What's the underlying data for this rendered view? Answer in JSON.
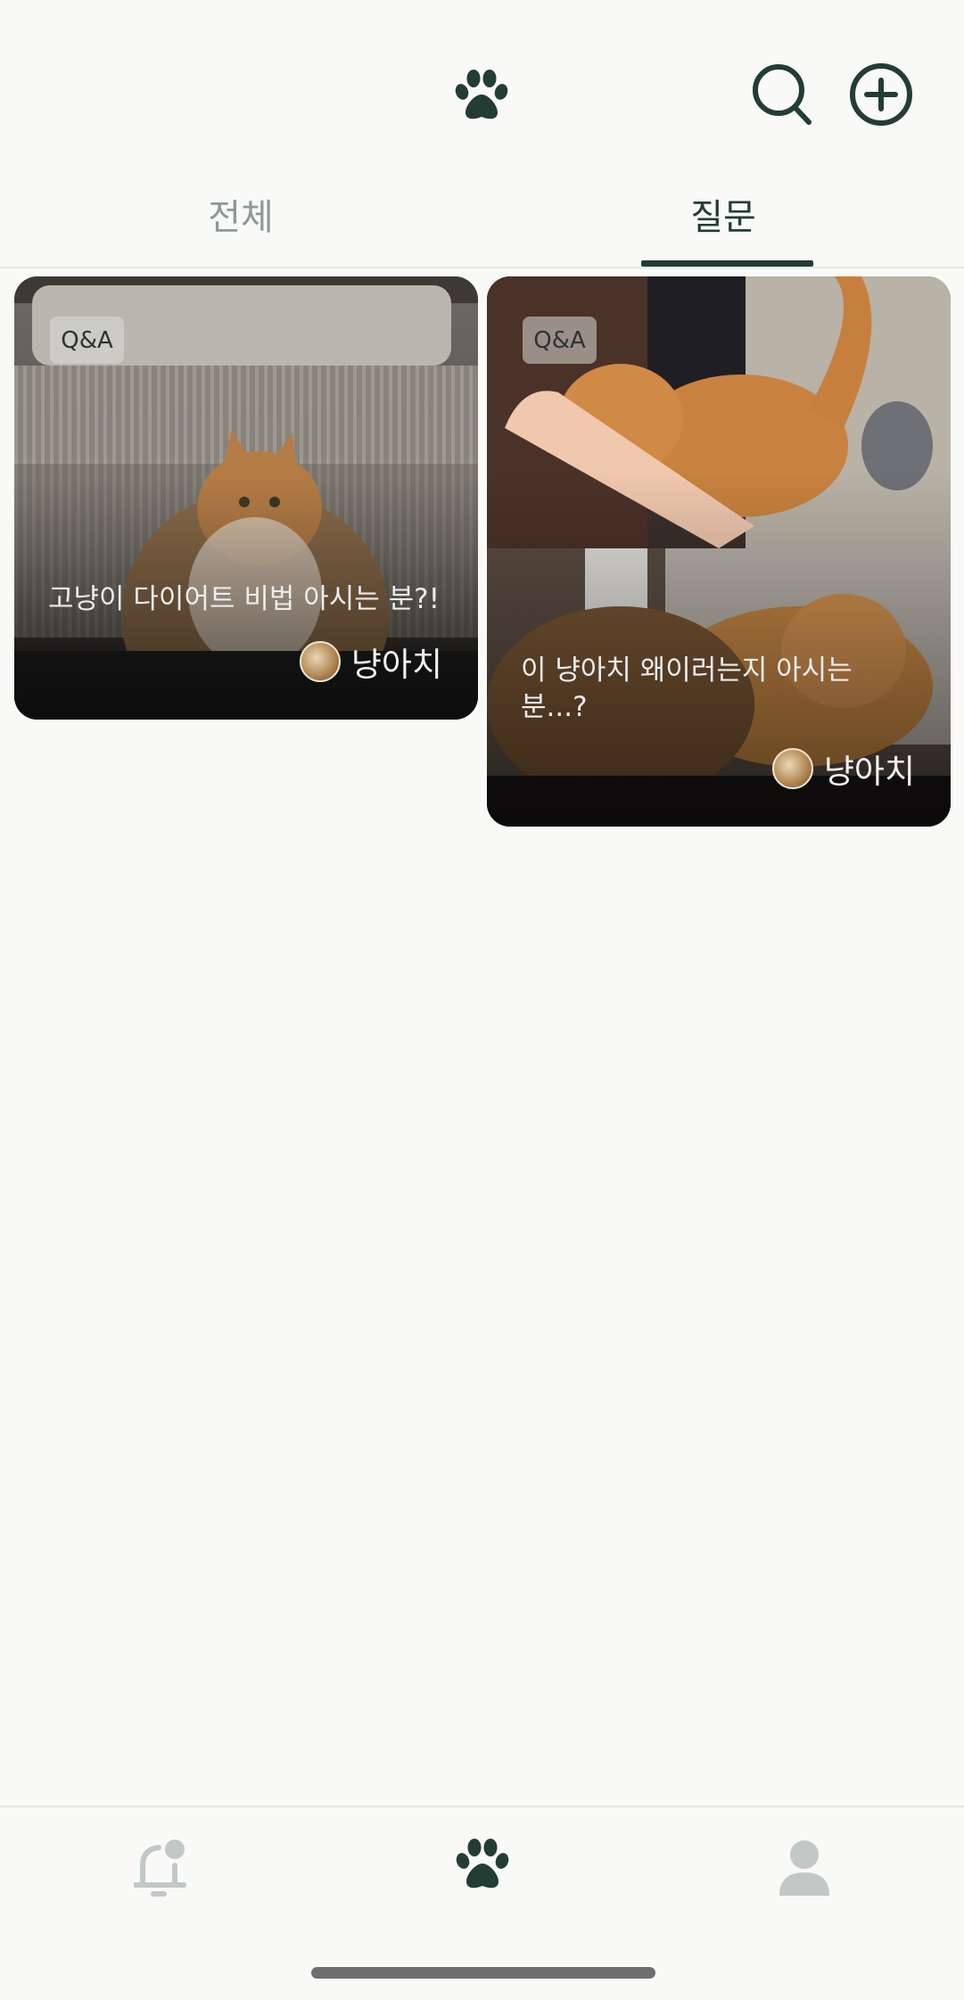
{
  "header": {
    "logo_icon": "paw-icon",
    "search_icon": "search-icon",
    "add_icon": "plus-circle-icon",
    "accent_color": "#233d35"
  },
  "tabs": [
    {
      "label": "전체",
      "active": false
    },
    {
      "label": "질문",
      "active": true
    }
  ],
  "cards": [
    {
      "badge": "Q&A",
      "title": "고냥이 다이어트 비법 아시는 분?!",
      "author": "냥아치"
    },
    {
      "badge": "Q&A",
      "title": "이 냥아치 왜이러는지 아시는 분...?",
      "author": "냥아치"
    }
  ],
  "bottom_nav": [
    {
      "icon": "bell-icon",
      "active": false
    },
    {
      "icon": "paw-icon",
      "active": true
    },
    {
      "icon": "person-icon",
      "active": false
    }
  ]
}
